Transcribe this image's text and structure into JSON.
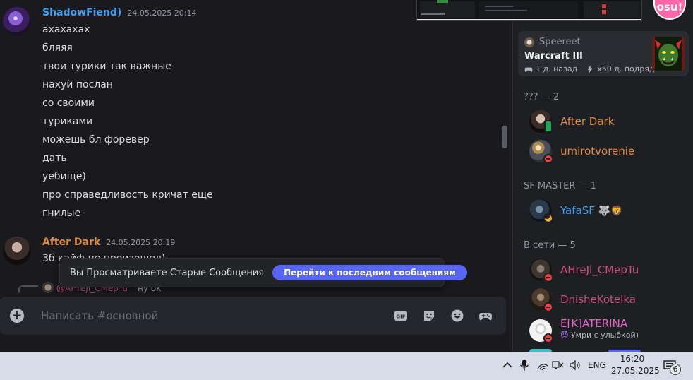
{
  "chat": {
    "groups": [
      {
        "author": "ShadowFiend)",
        "author_color": "#3ea2f5",
        "timestamp": "24.05.2025 20:14",
        "lines": [
          "ахахахах",
          "бляяя",
          "твои турики так важные",
          "нахуй послан",
          "со своими",
          "туриками",
          "можешь бл форевер",
          "дать",
          "уебище)",
          "про справедливость кричат еще",
          "гнилые"
        ]
      },
      {
        "author": "After Dark",
        "author_color": "#e08a3c",
        "timestamp": "24.05.2025 20:19",
        "lines": [
          "3б кайф не произошел)"
        ]
      }
    ],
    "reply": {
      "name": "@AHreJl_CMepTu",
      "text": "ну ок"
    },
    "old_messages_bar": {
      "text": "Вы Просматриваете Старые Сообщения",
      "button": "Перейти к последним сообщениям"
    },
    "composer": {
      "placeholder": "Написать #основной",
      "icons": [
        "add-icon",
        "gif-icon",
        "sticker-icon",
        "emoji-icon",
        "gamepad-icon"
      ]
    }
  },
  "sidebar": {
    "top_logo": "osu!",
    "activity_card": {
      "user": "Speereet",
      "game": "Warcraft III",
      "last_played": "1 д. назад",
      "streak": "x50 д. подряд"
    },
    "sections": [
      {
        "header": "??? — 2",
        "members": [
          {
            "name": "After Dark",
            "color": "#e08a3c",
            "status": "mobile"
          },
          {
            "name": "umirotvorenie",
            "color": "#e08a3c",
            "status": "dnd"
          }
        ]
      },
      {
        "header": "SF MASTER — 1",
        "members": [
          {
            "name": "YafaSF",
            "color": "#3ea2f5",
            "status": "idle",
            "emoji": "🐺🦁"
          }
        ]
      },
      {
        "header": "В сети — 5",
        "members": [
          {
            "name": "AHreJl_CMepTu",
            "color": "#c8557b",
            "status": "dnd"
          },
          {
            "name": "DnisheKotelka",
            "color": "#c8557b",
            "status": "dnd"
          },
          {
            "name": "E[K]ATERINA",
            "color": "#e667c8",
            "status": "dnd",
            "status_text": "Умри с улыбкой)"
          }
        ]
      }
    ]
  },
  "taskbar": {
    "language": "ENG",
    "time": "16:20",
    "date": "27.05.2025",
    "notifications": "6"
  }
}
